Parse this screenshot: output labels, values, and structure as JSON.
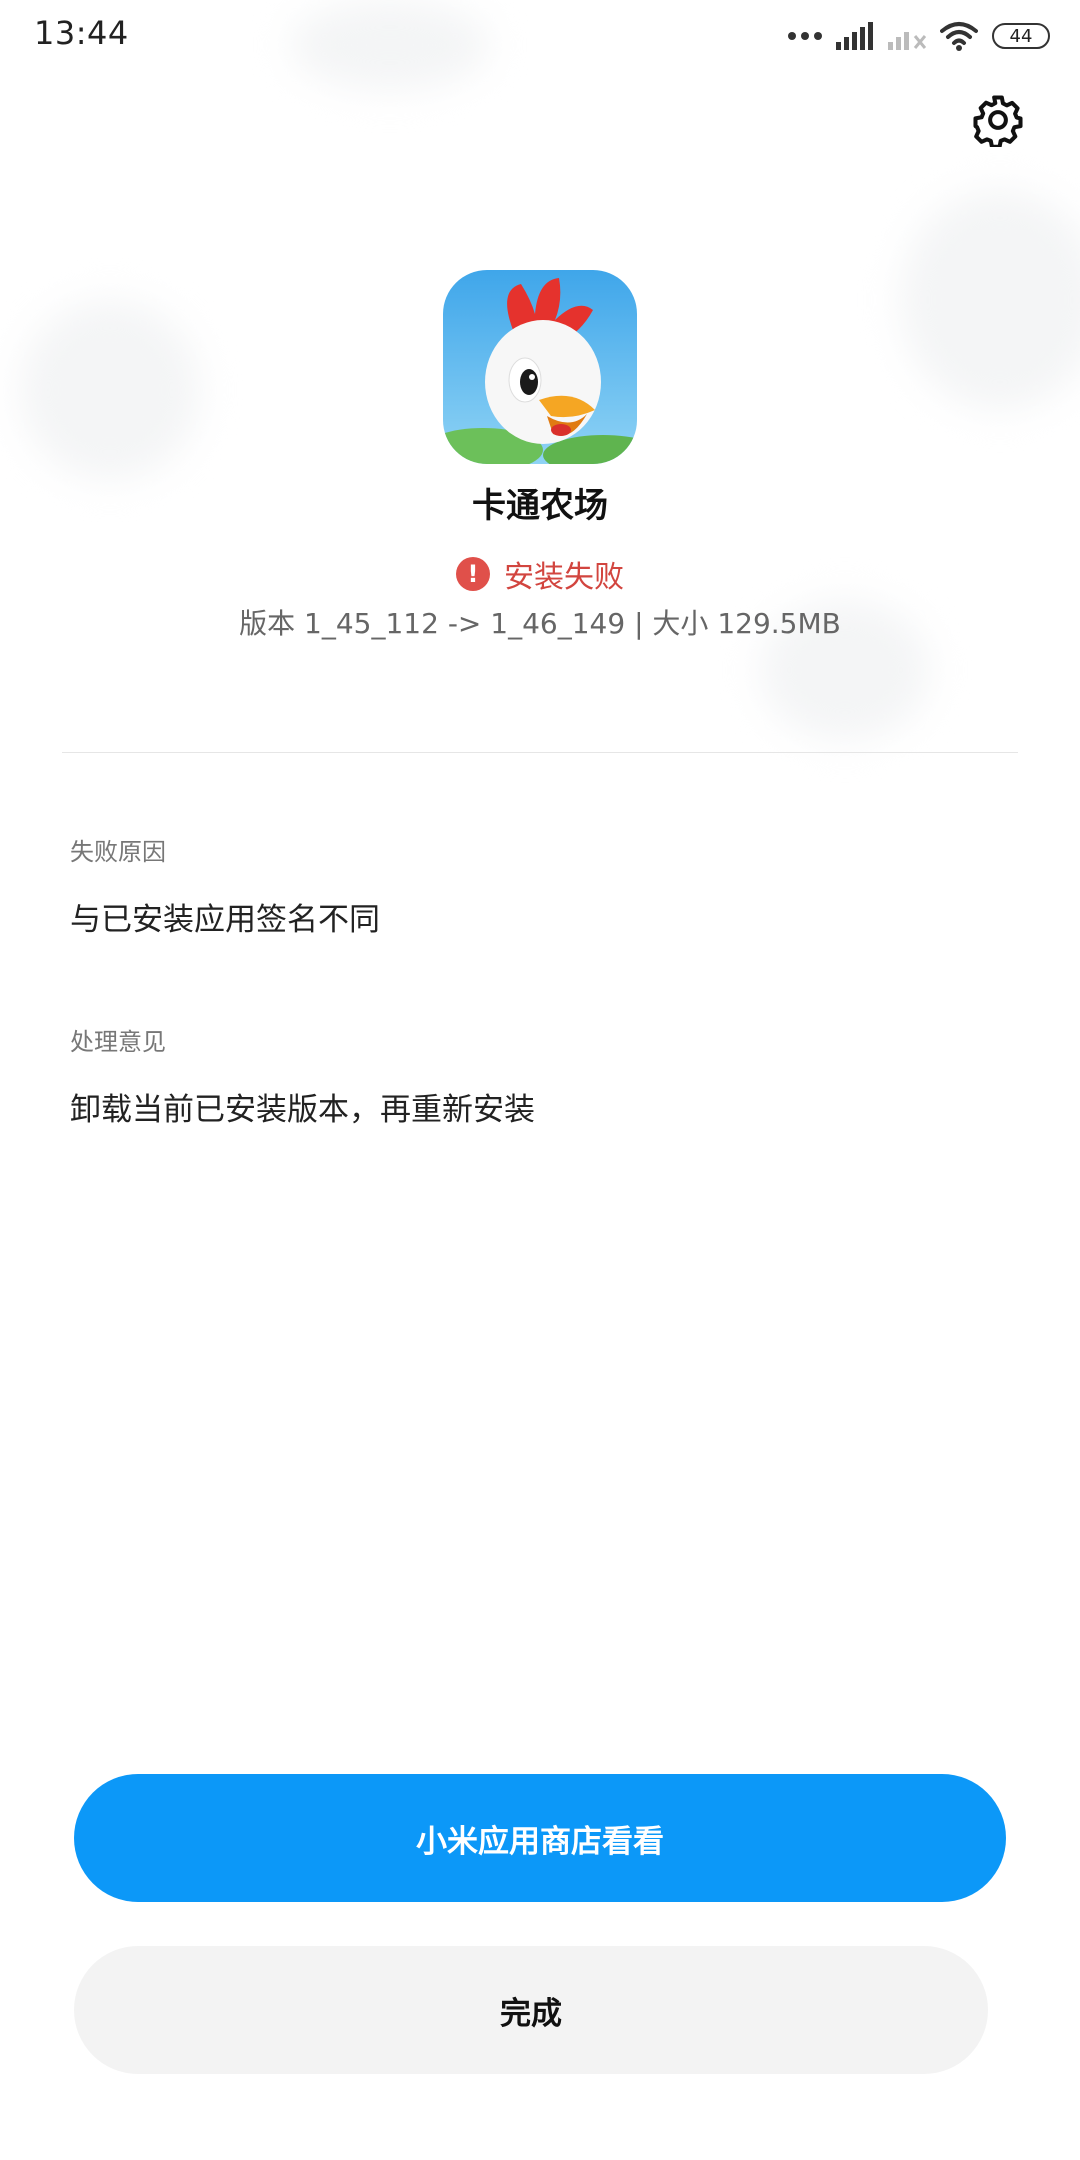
{
  "status_bar": {
    "time": "13:44",
    "battery": "44",
    "icons": [
      "more-dots-icon",
      "signal-icon",
      "signal-no-service-icon",
      "wifi-icon",
      "battery-icon"
    ]
  },
  "settings": {
    "icon": "gear-icon"
  },
  "app": {
    "icon": "rooster-app-icon",
    "name": "卡通农场",
    "status": "安装失败",
    "status_color": "#d2453f",
    "version_info": "版本 1_45_112 -> 1_46_149 | 大小 129.5MB"
  },
  "failure": {
    "reason_label": "失败原因",
    "reason_value": "与已安装应用签名不同",
    "advice_label": "处理意见",
    "advice_value": "卸载当前已安装版本，再重新安装"
  },
  "actions": {
    "store_label": "小米应用商店看看",
    "store_color": "#0c98f8",
    "done_label": "完成"
  }
}
